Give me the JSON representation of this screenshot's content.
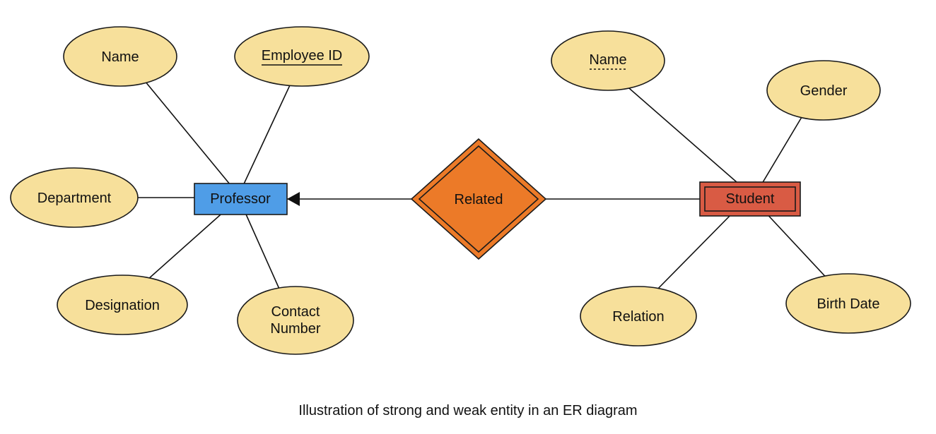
{
  "caption": "Illustration of strong and weak entity in an ER diagram",
  "entities": {
    "professor": {
      "label": "Professor",
      "type": "strong"
    },
    "student": {
      "label": "Student",
      "type": "weak"
    }
  },
  "relationship": {
    "label": "Related",
    "type": "identifying"
  },
  "professor_attributes": {
    "name": {
      "label": "Name",
      "key": false
    },
    "employee_id": {
      "label": "Employee ID",
      "key": true
    },
    "department": {
      "label": "Department",
      "key": false
    },
    "designation": {
      "label": "Designation",
      "key": false
    },
    "contact_l1": {
      "label": "Contact",
      "key": false
    },
    "contact_l2": {
      "label": "Number",
      "key": false
    }
  },
  "student_attributes": {
    "name": {
      "label": "Name",
      "discriminator": true
    },
    "gender": {
      "label": "Gender",
      "discriminator": false
    },
    "relation": {
      "label": "Relation",
      "discriminator": false
    },
    "birthdate": {
      "label": "Birth Date",
      "discriminator": false
    }
  },
  "colors": {
    "attribute_fill": "#f7e09b",
    "attribute_stroke": "#1a1a1a",
    "strong_entity_fill": "#4f9de7",
    "weak_entity_fill": "#d95b44",
    "relationship_fill": "#ec7a28",
    "shape_stroke": "#1a1a1a"
  }
}
